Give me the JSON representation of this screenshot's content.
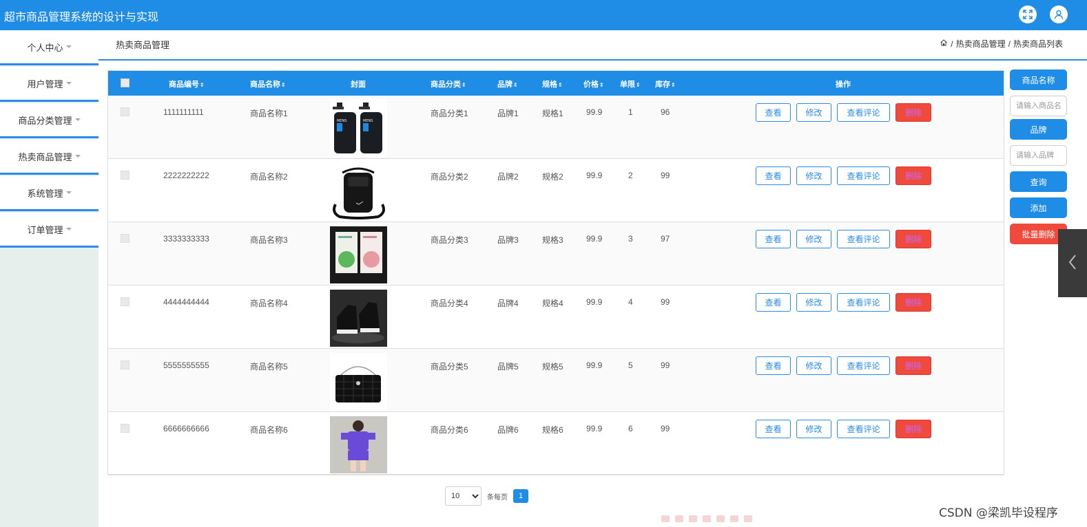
{
  "app": {
    "title": "超市商品管理系统的设计与实现"
  },
  "sidebar": {
    "items": [
      {
        "label": "个人中心"
      },
      {
        "label": "用户管理"
      },
      {
        "label": "商品分类管理"
      },
      {
        "label": "热卖商品管理"
      },
      {
        "label": "系统管理"
      },
      {
        "label": "订单管理"
      }
    ]
  },
  "header": {
    "page_title": "热卖商品管理",
    "breadcrumb": [
      "热卖商品管理",
      "热卖商品列表"
    ],
    "separator": "/"
  },
  "table": {
    "columns": [
      "商品编号",
      "商品名称",
      "封面",
      "商品分类",
      "品牌",
      "规格",
      "价格",
      "单限",
      "库存",
      "操作"
    ],
    "action_labels": {
      "view": "查看",
      "edit": "修改",
      "review": "查看评论",
      "delete": "删除"
    },
    "rows": [
      {
        "id": "1111111111",
        "name": "商品名称1",
        "cover": "洗面奶双瓶装",
        "category": "商品分类1",
        "brand": "品牌1",
        "spec": "规格1",
        "price": "99.9",
        "limit": "1",
        "stock": "96"
      },
      {
        "id": "2222222222",
        "name": "商品名称2",
        "cover": "黑色挎包",
        "category": "商品分类2",
        "brand": "品牌2",
        "spec": "规格2",
        "price": "99.9",
        "limit": "2",
        "stock": "99"
      },
      {
        "id": "3333333333",
        "name": "商品名称3",
        "cover": "面膜",
        "category": "商品分类3",
        "brand": "品牌3",
        "spec": "规格3",
        "price": "99.9",
        "limit": "3",
        "stock": "97"
      },
      {
        "id": "4444444444",
        "name": "商品名称4",
        "cover": "黑色高帮鞋",
        "category": "商品分类4",
        "brand": "品牌4",
        "spec": "规格4",
        "price": "99.9",
        "limit": "4",
        "stock": "99"
      },
      {
        "id": "5555555555",
        "name": "商品名称5",
        "cover": "菱格链条包",
        "category": "商品分类5",
        "brand": "品牌5",
        "spec": "规格5",
        "price": "99.9",
        "limit": "5",
        "stock": "99"
      },
      {
        "id": "6666666666",
        "name": "商品名称6",
        "cover": "紫色套装",
        "category": "商品分类6",
        "brand": "品牌6",
        "spec": "规格6",
        "price": "99.9",
        "limit": "6",
        "stock": "99"
      }
    ]
  },
  "search": {
    "name_label": "商品名称",
    "name_placeholder": "请输入商品名称",
    "brand_label": "品牌",
    "brand_placeholder": "请输入品牌",
    "query_label": "查询",
    "add_label": "添加",
    "batch_delete_label": "批量删除"
  },
  "pagination": {
    "page_size": "10",
    "per_page_label": "条每页",
    "current_page": "1"
  },
  "watermark": "CSDN @梁凯毕设程序",
  "colors": {
    "primary": "#1f8ce6",
    "danger": "#f04a3c",
    "sidebar_bg": "#e6efeb"
  },
  "icons": [
    "fullscreen-icon",
    "user-icon",
    "home-icon",
    "caret-down-icon",
    "sort-icon",
    "chevron-left-icon"
  ]
}
